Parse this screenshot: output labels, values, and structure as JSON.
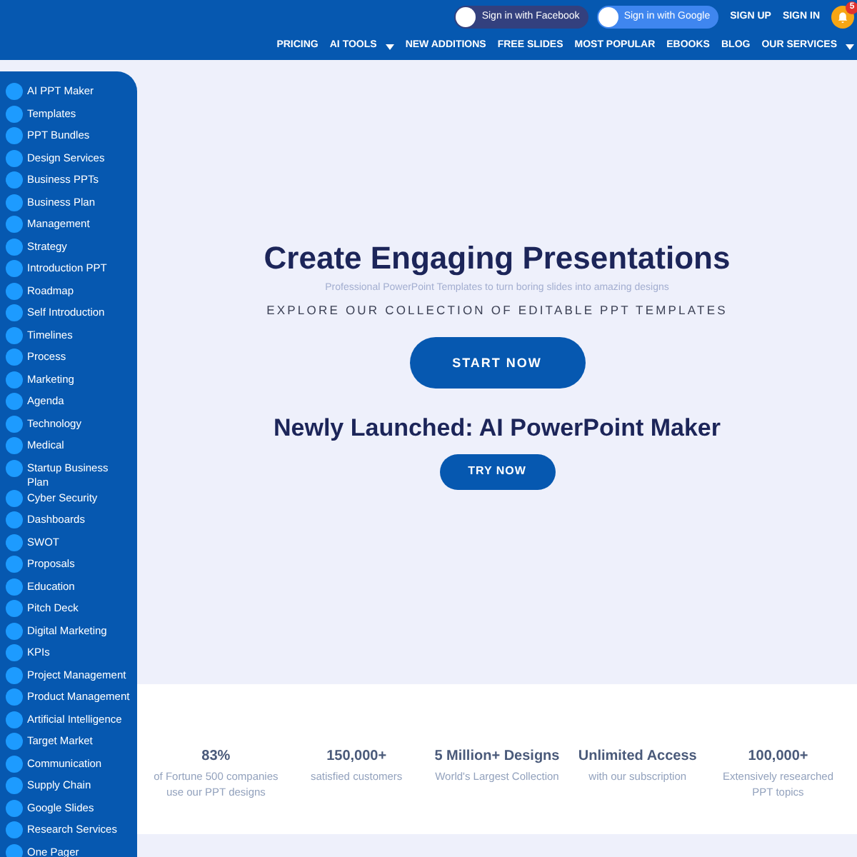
{
  "header": {
    "sign_in_buttons": [
      {
        "label": "Sign in with Facebook",
        "kind": "facebook"
      },
      {
        "label": "Sign in with Google",
        "kind": "google"
      }
    ],
    "links": [
      "SIGN UP",
      "SIGN IN"
    ],
    "notifications": {
      "badge": "5"
    },
    "nav": [
      {
        "label": "PRICING",
        "dropdown": false
      },
      {
        "label": "AI TOOLS",
        "dropdown": true
      },
      {
        "label": "NEW ADDITIONS",
        "dropdown": false
      },
      {
        "label": "FREE SLIDES",
        "dropdown": false
      },
      {
        "label": "MOST POPULAR",
        "dropdown": false
      },
      {
        "label": "EBOOKS",
        "dropdown": false
      },
      {
        "label": "BLOG",
        "dropdown": false
      },
      {
        "label": "OUR SERVICES",
        "dropdown": true
      }
    ]
  },
  "sidebar": {
    "items": [
      "AI PPT Maker",
      "Templates",
      "PPT Bundles",
      "Design Services",
      "Business PPTs",
      "Business Plan",
      "Management",
      "Strategy",
      "Introduction PPT",
      "Roadmap",
      "Self Introduction",
      "Timelines",
      "Process",
      "Marketing",
      "Agenda",
      "Technology",
      "Medical",
      "Startup Business Plan",
      "Cyber Security",
      "Dashboards",
      "SWOT",
      "Proposals",
      "Education",
      "Pitch Deck",
      "Digital Marketing",
      "KPIs",
      "Project Management",
      "Product Management",
      "Artificial Intelligence",
      "Target Market",
      "Communication",
      "Supply Chain",
      "Google Slides",
      "Research Services",
      "One Pager"
    ]
  },
  "hero": {
    "title": "Create Engaging Presentations",
    "subtitle": "Professional PowerPoint Templates to turn boring slides into amazing designs",
    "tagline": "EXPLORE OUR COLLECTION OF EDITABLE PPT TEMPLATES",
    "button": "START NOW",
    "promo_title": "Newly Launched: AI PowerPoint Maker",
    "promo_button": "TRY NOW"
  },
  "stats": [
    {
      "value": "83%",
      "caption": "of Fortune 500 companies use our PPT designs"
    },
    {
      "value": "150,000+",
      "caption": "satisfied customers"
    },
    {
      "value": "5 Million+ Designs",
      "caption": "World's Largest Collection"
    },
    {
      "value": "Unlimited Access",
      "caption": "with our subscription"
    },
    {
      "value": "100,000+",
      "caption": "Extensively researched PPT topics"
    }
  ]
}
